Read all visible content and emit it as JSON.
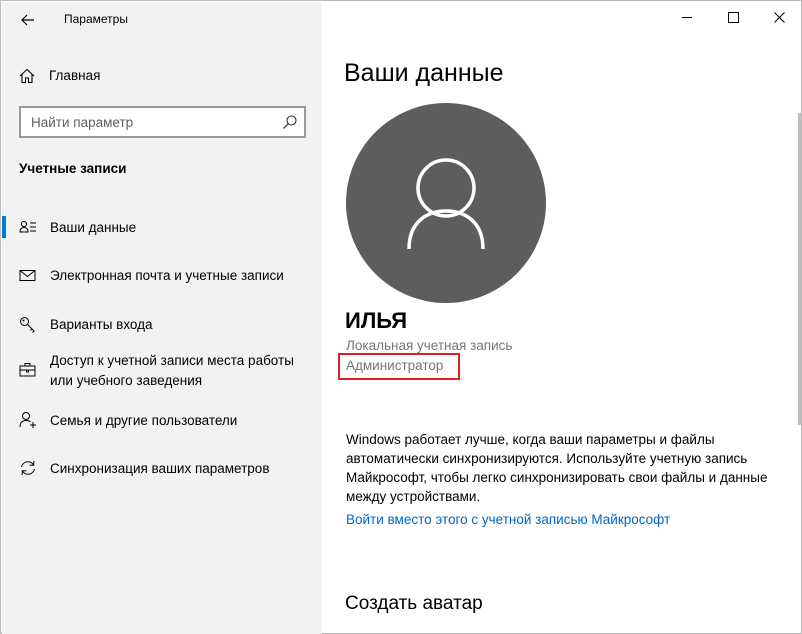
{
  "titlebar": {
    "app_title": "Параметры",
    "buttons": [
      "minimize-icon",
      "maximize-icon",
      "close-icon"
    ]
  },
  "sidebar": {
    "home_label": "Главная",
    "search_placeholder": "Найти параметр",
    "section_title": "Учетные записи",
    "items": [
      {
        "label": "Ваши данные",
        "icon": "person-card-icon",
        "active": true
      },
      {
        "label": "Электронная почта и учетные записи",
        "icon": "mail-icon",
        "active": false
      },
      {
        "label": "Варианты входа",
        "icon": "key-icon",
        "active": false
      },
      {
        "label": "Доступ к учетной записи места работы или учебного заведения",
        "icon": "briefcase-icon",
        "active": false
      },
      {
        "label": "Семья и другие пользователи",
        "icon": "person-add-icon",
        "active": false
      },
      {
        "label": "Синхронизация ваших параметров",
        "icon": "sync-icon",
        "active": false
      }
    ]
  },
  "main": {
    "title": "Ваши данные",
    "user_name": "ИЛЬЯ",
    "account_type": "Локальная учетная запись",
    "role": "Администратор",
    "description": "Windows работает лучше, когда ваши параметры и файлы автоматически синхронизируются. Используйте учетную запись Майкрософт, чтобы легко синхронизировать свои файлы и данные между устройствами.",
    "ms_link": "Войти вместо этого с учетной записью Майкрософт",
    "create_avatar_heading": "Создать аватар"
  },
  "colors": {
    "accent": "#0078d7",
    "link": "#0067c0",
    "avatar_bg": "#5d5d5d",
    "highlight_box": "#e02020",
    "sidebar_bg": "#f2f2f2"
  }
}
